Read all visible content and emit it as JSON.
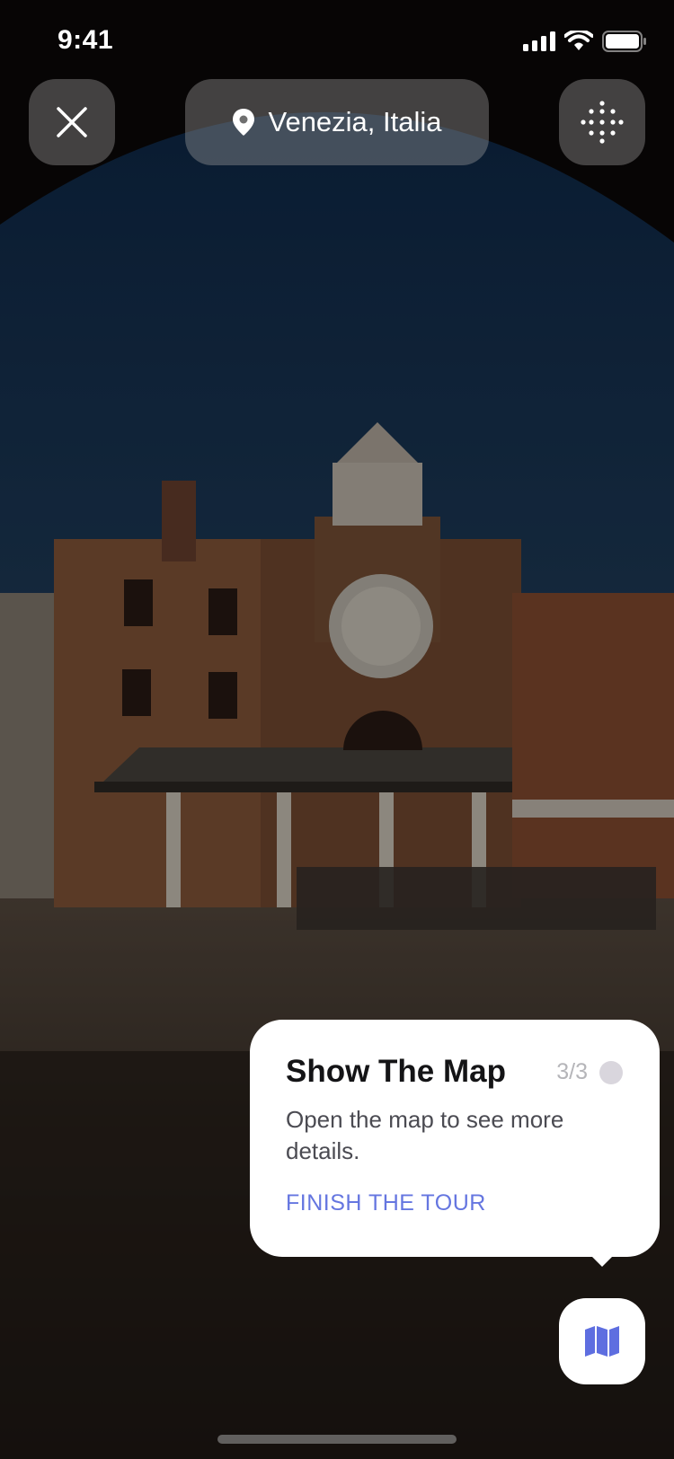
{
  "status_bar": {
    "time": "9:41"
  },
  "header": {
    "location": "Venezia, Italia",
    "close_icon": "close-icon",
    "location_icon": "location-pin-icon",
    "grid_icon": "dots-grid-icon"
  },
  "tour": {
    "title": "Show The Map",
    "step": "3/3",
    "description": "Open the map to see more details.",
    "action": "FINISH THE TOUR",
    "progress": 1.0
  },
  "map_button": {
    "icon": "map-icon"
  },
  "colors": {
    "accent": "#6576e0",
    "card": "#ffffff",
    "overlay": "#000000"
  }
}
